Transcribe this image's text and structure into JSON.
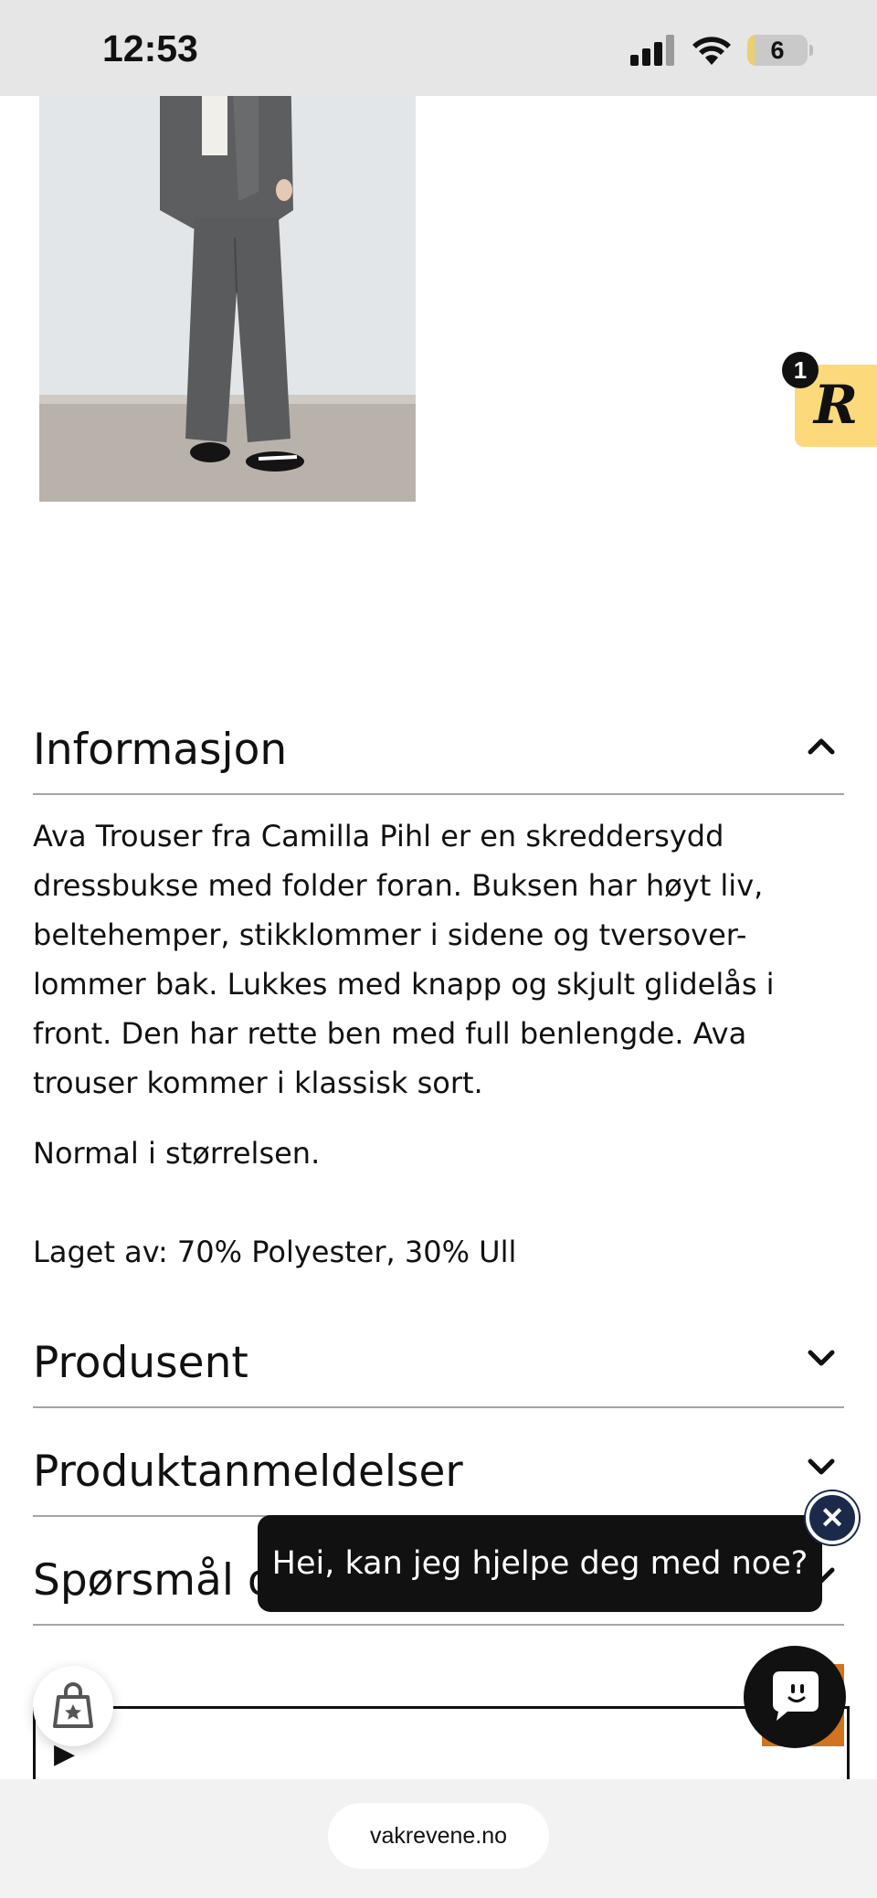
{
  "status_bar": {
    "time": "12:53",
    "battery_level": "6",
    "battery_fraction": 0.12,
    "icons": [
      "cellular-signal-icon",
      "wifi-icon",
      "battery-icon"
    ]
  },
  "review_widget": {
    "logo": "R",
    "badge_count": "1",
    "color": "#fcd97b"
  },
  "sections": {
    "info": {
      "title": "Informasjon",
      "expanded": true,
      "description": "Ava Trouser fra Camilla Pihl er en skreddersydd dressbukse med folder foran. Buksen har høyt liv, beltehemper, stikklommer i sidene og tversover-lommer bak.  Lukkes med knapp og skjult glidelås i front. Den har rette ben med full benlengde. Ava trouser kommer i klassisk sort.",
      "size_note": "Normal i størrelsen.",
      "material": "Laget av: 70% Polyester, 30% Ull"
    },
    "producer": {
      "title": "Produsent",
      "expanded": false
    },
    "reviews": {
      "title": "Produktanmeldelser",
      "expanded": false
    },
    "questions": {
      "title": "Spørsmål og svar",
      "expanded": false
    }
  },
  "chat": {
    "message": "Hei, kan jeg hjelpe deg med noe?",
    "close_icon": "close-icon",
    "launcher_icon": "chat-smile-icon"
  },
  "browser": {
    "url": "vakrevene.no"
  },
  "colors": {
    "text": "#111111",
    "divider": "#a4a4a4",
    "accent_orange": "#d0741f",
    "chat_close": "#1b2a4a"
  }
}
